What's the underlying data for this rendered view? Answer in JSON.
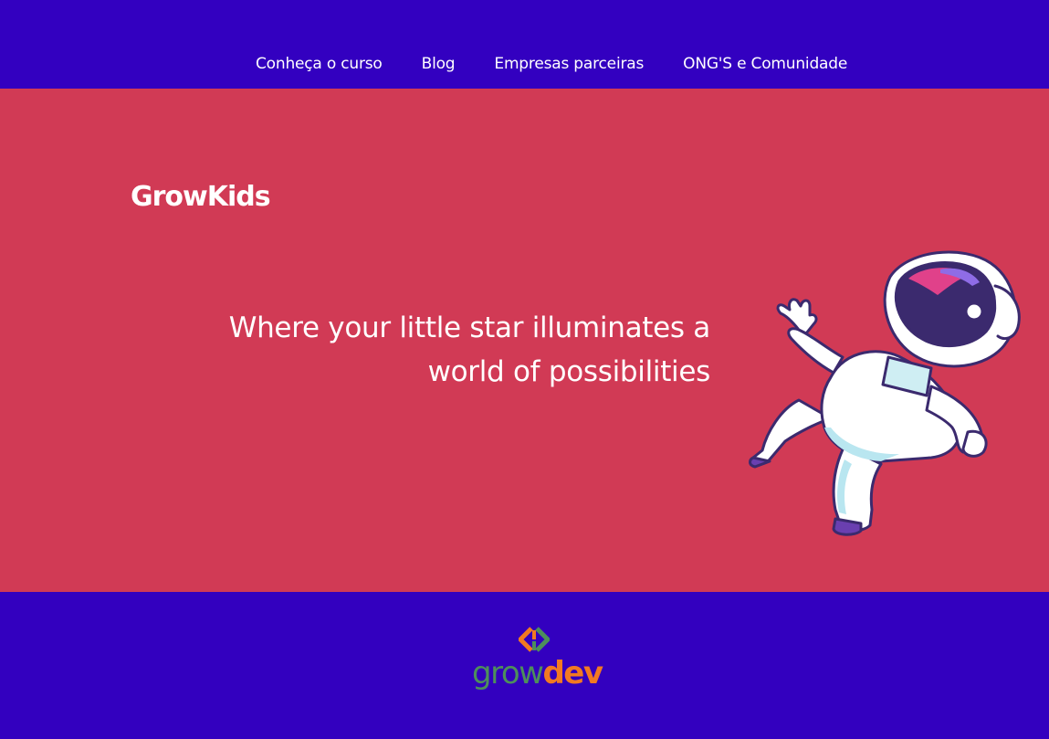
{
  "nav": {
    "items": [
      {
        "label": "Conheça o curso"
      },
      {
        "label": "Blog"
      },
      {
        "label": "Empresas parceiras"
      },
      {
        "label": "ONG'S e Comunidade"
      }
    ]
  },
  "hero": {
    "brand": "GrowKids",
    "tagline": "Where your little star illuminates a world of possibilities",
    "illustration": "astronaut-illustration"
  },
  "footer": {
    "logo": {
      "grow": "grow",
      "dev": "dev",
      "mark": "code-brackets-icon"
    }
  },
  "colors": {
    "nav_bg": "#3300c0",
    "hero_bg": "#d13a55",
    "logo_green": "#4d8f5b",
    "logo_orange": "#f27922"
  }
}
